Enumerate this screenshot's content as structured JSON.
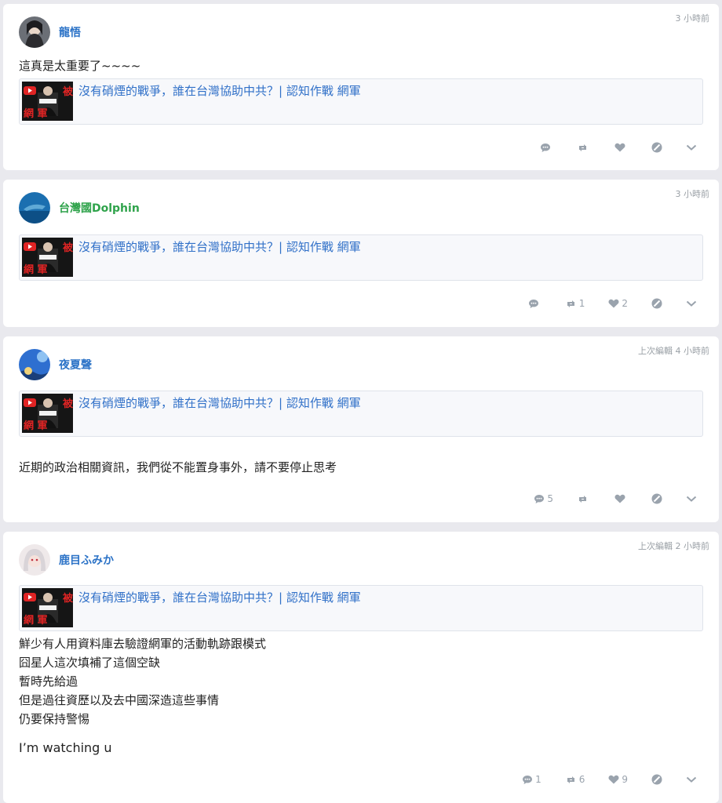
{
  "link_card": {
    "title": "沒有硝煙的戰爭，誰在台灣協助中共？| 認知作戰 網軍"
  },
  "posts": [
    {
      "username": "龍悟",
      "time": "3 小時前",
      "text": "這真是太重要了~~~~",
      "actions": {
        "comments": "",
        "reposts": "",
        "likes": ""
      }
    },
    {
      "username": "台灣國Dolphin",
      "time": "3 小時前",
      "actions": {
        "comments": "",
        "reposts": "1",
        "likes": "2"
      }
    },
    {
      "username": "夜夏聲",
      "time": "上次編輯 4 小時前",
      "text": "近期的政治相關資訊，我們從不能置身事外，請不要停止思考",
      "actions": {
        "comments": "5",
        "reposts": "",
        "likes": ""
      }
    },
    {
      "username": "鹿目ふみか",
      "time": "上次編輯 2 小時前",
      "lines": [
        "鮮少有人用資料庫去驗證網軍的活動軌跡跟模式",
        "囧星人這次填補了這個空缺",
        "暫時先給過",
        "但是過往資歷以及去中國深造這些事情",
        "仍要保持警惕"
      ],
      "extra": "I’m watching u",
      "actions": {
        "comments": "1",
        "reposts": "6",
        "likes": "9"
      }
    }
  ],
  "thumbnail": {
    "text_top": "被",
    "text_bottom": "網 軍"
  },
  "icons": [
    "comment-icon",
    "repost-icon",
    "heart-icon",
    "block-icon",
    "chevron-down-icon"
  ],
  "colors": {
    "username": "#2c73c7",
    "username_green": "#2fa34b",
    "link": "#3070c8",
    "icon": "#9aa3ad"
  }
}
